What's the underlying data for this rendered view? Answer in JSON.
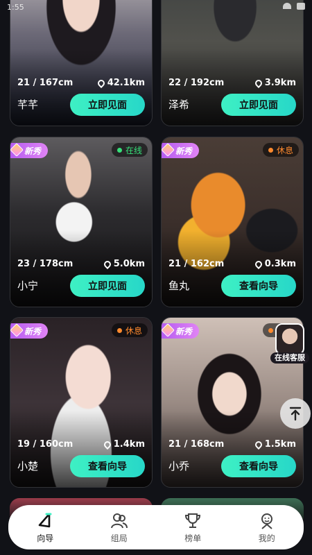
{
  "status_bar": {
    "time": "1:55"
  },
  "cards": [
    {
      "stats": "21 / 167cm",
      "distance": "42.1km",
      "name": "芊芊",
      "action": "立即见面",
      "new_badge": null,
      "status": null
    },
    {
      "stats": "22 / 192cm",
      "distance": "3.9km",
      "name": "泽希",
      "action": "立即见面",
      "new_badge": null,
      "status": null
    },
    {
      "stats": "23 / 178cm",
      "distance": "5.0km",
      "name": "小宁",
      "action": "立即见面",
      "new_badge": "新秀",
      "status": "在线"
    },
    {
      "stats": "21 / 162cm",
      "distance": "0.3km",
      "name": "鱼丸",
      "action": "查看向导",
      "new_badge": "新秀",
      "status": "休息"
    },
    {
      "stats": "19 / 160cm",
      "distance": "1.4km",
      "name": "小楚",
      "action": "查看向导",
      "new_badge": "新秀",
      "status": "休息"
    },
    {
      "stats": "21 / 168cm",
      "distance": "1.5km",
      "name": "小乔",
      "action": "查看向导",
      "new_badge": "新秀",
      "status": "休息"
    }
  ],
  "floating": {
    "customer_service": "在线客服",
    "scroll_top_icon": "arrow-up-to-top-icon"
  },
  "tabbar": {
    "tabs": [
      {
        "label": "向导",
        "icon": "guide-arrow-icon",
        "active": true
      },
      {
        "label": "组局",
        "icon": "group-icon",
        "active": false
      },
      {
        "label": "榜单",
        "icon": "trophy-icon",
        "active": false
      },
      {
        "label": "我的",
        "icon": "profile-icon",
        "active": false
      }
    ]
  },
  "colors": {
    "background": "#111217",
    "action_button": "#3ef0c4",
    "new_badge": "#b65cf0",
    "online": "#37e07a",
    "rest": "#ff8a2e"
  }
}
